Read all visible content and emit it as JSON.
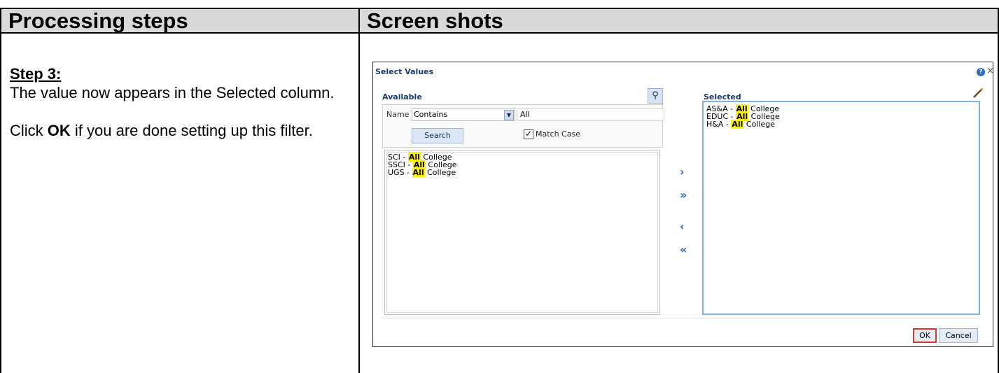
{
  "headers": {
    "left": "Processing steps",
    "right": "Screen shots"
  },
  "instructions": {
    "step_title": "Step 3:",
    "line1": "The value now appears in the Selected column.",
    "line2_pre": "Click ",
    "line2_bold": "OK",
    "line2_post": " if you are done setting up this filter."
  },
  "dialog": {
    "title": "Select Values",
    "available_label": "Available",
    "selected_label": "Selected",
    "name_label": "Name",
    "operator": "Contains",
    "filter_value": "All",
    "search_button": "Search",
    "match_case_label": "Match Case",
    "available_items": [
      {
        "prefix": "SCI - ",
        "match": "All",
        "suffix": " College"
      },
      {
        "prefix": "SSCI - ",
        "match": "All",
        "suffix": " College"
      },
      {
        "prefix": "UGS - ",
        "match": "All",
        "suffix": " College"
      }
    ],
    "selected_items": [
      {
        "prefix": "AS&A - ",
        "match": "All",
        "suffix": " College"
      },
      {
        "prefix": "EDUC - ",
        "match": "All",
        "suffix": " College"
      },
      {
        "prefix": "H&A - ",
        "match": "All",
        "suffix": " College"
      }
    ],
    "ok_button": "OK",
    "cancel_button": "Cancel",
    "icons": [
      "help-icon",
      "close-icon",
      "binoculars-icon",
      "pencil-icon",
      "move-right-icon",
      "move-all-right-icon",
      "move-left-icon",
      "move-all-left-icon",
      "pointer-arrow"
    ],
    "accent_color": "#d23a2a",
    "highlight_color": "#fff200"
  }
}
